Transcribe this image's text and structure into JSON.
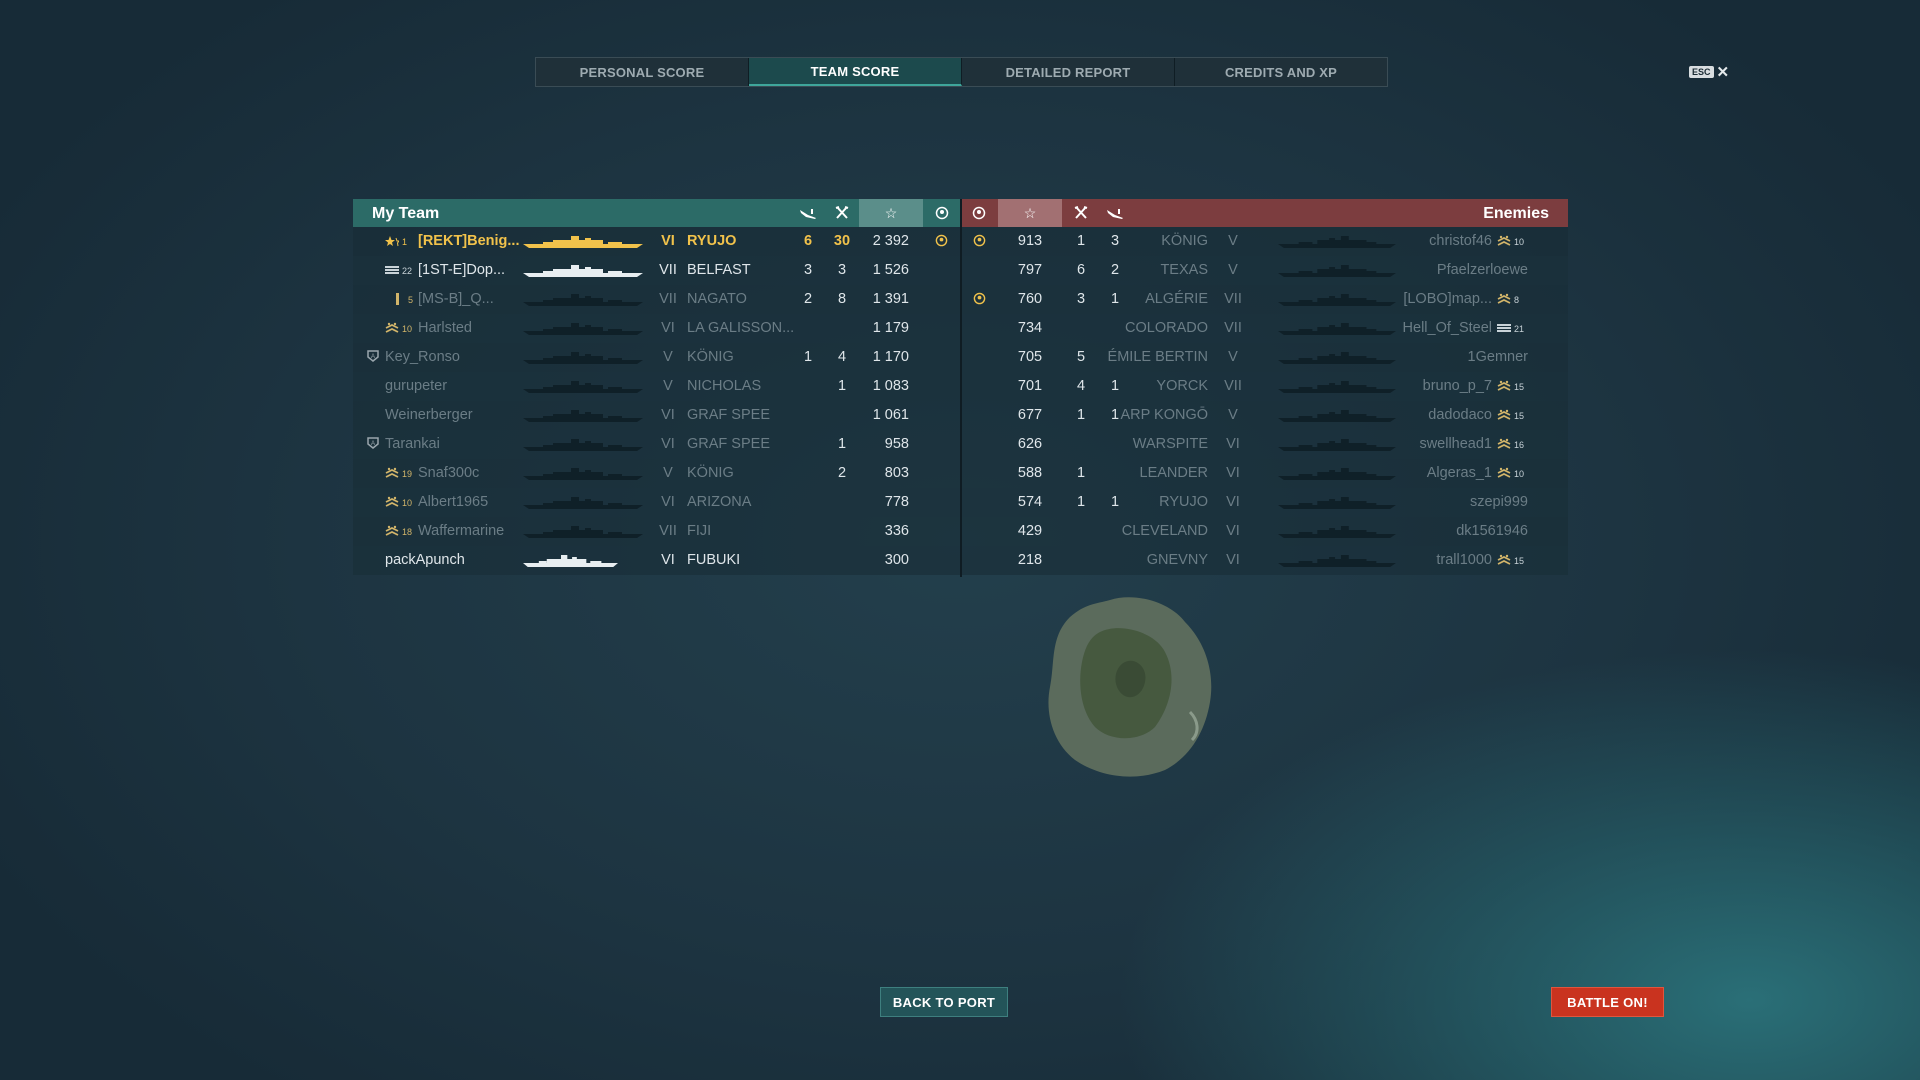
{
  "tabs": [
    {
      "label": "PERSONAL SCORE",
      "active": false
    },
    {
      "label": "TEAM SCORE",
      "active": true
    },
    {
      "label": "DETAILED REPORT",
      "active": false
    },
    {
      "label": "CREDITS AND XP",
      "active": false
    }
  ],
  "esc": {
    "key": "ESC",
    "close": "✕"
  },
  "my_team": {
    "title": "My Team",
    "columns": [
      "planes-destroyed-icon",
      "ships-destroyed-icon",
      "score-star-icon",
      "detection-icon"
    ],
    "rows": [
      {
        "rank": "1",
        "player": "[REKT]Benig...",
        "tier": "VI",
        "ship": "RYUJO",
        "planes": "6",
        "kills": "30",
        "score": "2 392",
        "spotted": true,
        "style": "gold",
        "rank_icon": "star"
      },
      {
        "rank": "22",
        "player": "[1ST-E]Dop...",
        "tier": "VII",
        "ship": "BELFAST",
        "planes": "3",
        "kills": "3",
        "score": "1 526",
        "spotted": false,
        "style": "bright",
        "rank_icon": "bars"
      },
      {
        "rank": "5",
        "player": "[MS-B]_Q...",
        "tier": "VII",
        "ship": "NAGATO",
        "planes": "2",
        "kills": "8",
        "score": "1 391",
        "spotted": false,
        "style": "dim",
        "rank_icon": "single"
      },
      {
        "rank": "10",
        "player": "Harlsted",
        "tier": "VI",
        "ship": "LA GALISSON...",
        "planes": "",
        "kills": "",
        "score": "1 179",
        "spotted": false,
        "style": "dim",
        "rank_icon": "chevrons"
      },
      {
        "rank": "",
        "player": "Key_Ronso",
        "tier": "V",
        "ship": "KÖNIG",
        "planes": "1",
        "kills": "4",
        "score": "1 170",
        "spotted": false,
        "style": "dim",
        "rank_icon": "shield"
      },
      {
        "rank": "",
        "player": "gurupeter",
        "tier": "V",
        "ship": "NICHOLAS",
        "planes": "",
        "kills": "1",
        "score": "1 083",
        "spotted": false,
        "style": "dim",
        "rank_icon": ""
      },
      {
        "rank": "",
        "player": "Weinerberger",
        "tier": "VI",
        "ship": "GRAF SPEE",
        "planes": "",
        "kills": "",
        "score": "1 061",
        "spotted": false,
        "style": "dim",
        "rank_icon": ""
      },
      {
        "rank": "",
        "player": "Tarankai",
        "tier": "VI",
        "ship": "GRAF SPEE",
        "planes": "",
        "kills": "1",
        "score": "958",
        "spotted": false,
        "style": "dim",
        "rank_icon": "shield"
      },
      {
        "rank": "19",
        "player": "Snaf300c",
        "tier": "V",
        "ship": "KÖNIG",
        "planes": "",
        "kills": "2",
        "score": "803",
        "spotted": false,
        "style": "dim",
        "rank_icon": "chevrons"
      },
      {
        "rank": "10",
        "player": "Albert1965",
        "tier": "VI",
        "ship": "ARIZONA",
        "planes": "",
        "kills": "",
        "score": "778",
        "spotted": false,
        "style": "dim",
        "rank_icon": "chevrons"
      },
      {
        "rank": "18",
        "player": "Waffermarine",
        "tier": "VII",
        "ship": "FIJI",
        "planes": "",
        "kills": "",
        "score": "336",
        "spotted": false,
        "style": "dim",
        "rank_icon": "chevrons"
      },
      {
        "rank": "",
        "player": "packApunch",
        "tier": "VI",
        "ship": "FUBUKI",
        "planes": "",
        "kills": "",
        "score": "300",
        "spotted": false,
        "style": "bright",
        "rank_icon": ""
      }
    ]
  },
  "enemies": {
    "title": "Enemies",
    "rows": [
      {
        "score": "913",
        "kills": "1",
        "planes": "3",
        "ship": "KÖNIG",
        "tier": "V",
        "player": "christof46",
        "rank": "10",
        "rank_icon": "chevrons",
        "spotted": true
      },
      {
        "score": "797",
        "kills": "6",
        "planes": "2",
        "ship": "TEXAS",
        "tier": "V",
        "player": "Pfaelzerloewe",
        "rank": "",
        "rank_icon": "",
        "spotted": false
      },
      {
        "score": "760",
        "kills": "3",
        "planes": "1",
        "ship": "ALGÉRIE",
        "tier": "VII",
        "player": "[LOBO]map...",
        "rank": "8",
        "rank_icon": "chevrons",
        "spotted": true
      },
      {
        "score": "734",
        "kills": "",
        "planes": "",
        "ship": "COLORADO",
        "tier": "VII",
        "player": "Hell_Of_Steel",
        "rank": "21",
        "rank_icon": "bars",
        "spotted": false
      },
      {
        "score": "705",
        "kills": "5",
        "planes": "",
        "ship": "ÉMILE BERTIN",
        "tier": "V",
        "player": "1Gemner",
        "rank": "",
        "rank_icon": "",
        "spotted": false
      },
      {
        "score": "701",
        "kills": "4",
        "planes": "1",
        "ship": "YORCK",
        "tier": "VII",
        "player": "bruno_p_7",
        "rank": "15",
        "rank_icon": "chevrons",
        "spotted": false
      },
      {
        "score": "677",
        "kills": "1",
        "planes": "1",
        "ship": "ARP KONGŌ",
        "tier": "V",
        "player": "dadodaco",
        "rank": "15",
        "rank_icon": "chevrons",
        "spotted": false
      },
      {
        "score": "626",
        "kills": "",
        "planes": "",
        "ship": "WARSPITE",
        "tier": "VI",
        "player": "swellhead1",
        "rank": "16",
        "rank_icon": "chevrons",
        "spotted": false
      },
      {
        "score": "588",
        "kills": "1",
        "planes": "",
        "ship": "LEANDER",
        "tier": "VI",
        "player": "Algeras_1",
        "rank": "10",
        "rank_icon": "chevrons",
        "spotted": false
      },
      {
        "score": "574",
        "kills": "1",
        "planes": "1",
        "ship": "RYUJO",
        "tier": "VI",
        "player": "szepi999",
        "rank": "",
        "rank_icon": "",
        "spotted": false
      },
      {
        "score": "429",
        "kills": "",
        "planes": "",
        "ship": "CLEVELAND",
        "tier": "VI",
        "player": "dk1561946",
        "rank": "",
        "rank_icon": "",
        "spotted": false
      },
      {
        "score": "218",
        "kills": "",
        "planes": "",
        "ship": "GNEVNY",
        "tier": "VI",
        "player": "trall1000",
        "rank": "15",
        "rank_icon": "chevrons",
        "spotted": false
      }
    ]
  },
  "buttons": {
    "back": "BACK TO PORT",
    "battle": "BATTLE ON!"
  },
  "colors": {
    "my_team": "#2c6b67",
    "enemies": "#7c3d3f",
    "gold": "#f1c24b",
    "battle": "#c9331f",
    "back": "#235459"
  }
}
